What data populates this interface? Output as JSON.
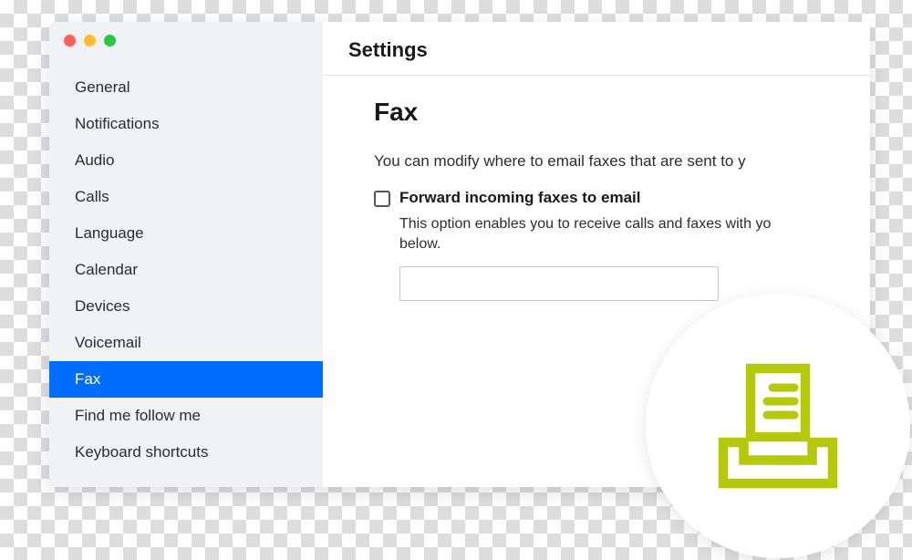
{
  "header": {
    "title": "Settings"
  },
  "sidebar": {
    "items": [
      {
        "label": "General",
        "name": "sidebar-item-general",
        "active": false
      },
      {
        "label": "Notifications",
        "name": "sidebar-item-notifications",
        "active": false
      },
      {
        "label": "Audio",
        "name": "sidebar-item-audio",
        "active": false
      },
      {
        "label": "Calls",
        "name": "sidebar-item-calls",
        "active": false
      },
      {
        "label": "Language",
        "name": "sidebar-item-language",
        "active": false
      },
      {
        "label": "Calendar",
        "name": "sidebar-item-calendar",
        "active": false
      },
      {
        "label": "Devices",
        "name": "sidebar-item-devices",
        "active": false
      },
      {
        "label": "Voicemail",
        "name": "sidebar-item-voicemail",
        "active": false
      },
      {
        "label": "Fax",
        "name": "sidebar-item-fax",
        "active": true
      },
      {
        "label": "Find me follow me",
        "name": "sidebar-item-find-me-follow-me",
        "active": false
      },
      {
        "label": "Keyboard shortcuts",
        "name": "sidebar-item-keyboard-shortcuts",
        "active": false
      }
    ]
  },
  "main": {
    "section_title": "Fax",
    "description": "You can modify where to email faxes that are sent to y",
    "checkbox_label": "Forward incoming faxes to email",
    "option_desc_line1": "This option enables you to receive calls and faxes with yo",
    "option_desc_line2": "below.",
    "email_value": ""
  },
  "colors": {
    "accent": "#006dff",
    "icon": "#b6c908"
  }
}
